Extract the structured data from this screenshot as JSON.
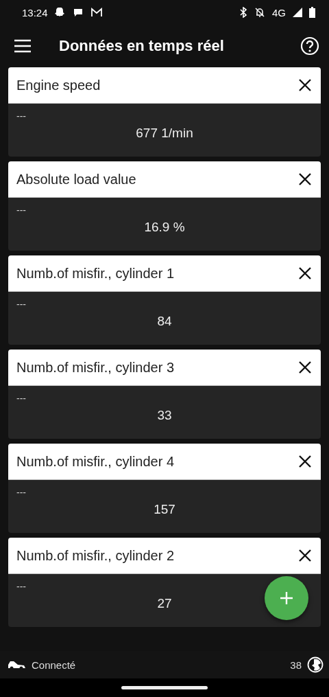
{
  "status_bar": {
    "time": "13:24",
    "network": "4G"
  },
  "app_bar": {
    "title": "Données en temps réel"
  },
  "cards": [
    {
      "title": "Engine speed",
      "subtitle": "---",
      "value": "677 1/min"
    },
    {
      "title": "Absolute load value",
      "subtitle": "---",
      "value": "16.9 %"
    },
    {
      "title": "Numb.of misfir., cylinder 1",
      "subtitle": "---",
      "value": "84"
    },
    {
      "title": "Numb.of misfir., cylinder 3",
      "subtitle": "---",
      "value": "33"
    },
    {
      "title": "Numb.of misfir., cylinder 4",
      "subtitle": "---",
      "value": "157"
    },
    {
      "title": "Numb.of misfir., cylinder 2",
      "subtitle": "---",
      "value": "27"
    }
  ],
  "footer": {
    "connection": "Connecté",
    "count": "38"
  }
}
